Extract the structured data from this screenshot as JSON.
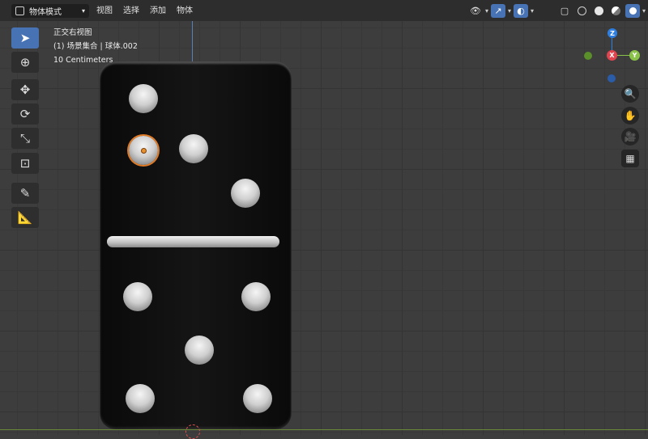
{
  "header": {
    "mode_label": "物体模式",
    "menus": [
      "视图",
      "选择",
      "添加",
      "物体"
    ]
  },
  "overlay": {
    "view_name": "正交右视图",
    "object_info": "(1) 场景集合 | 球体.002",
    "scale_label": "10 Centimeters"
  },
  "toolbar": {
    "tools": [
      "select-box",
      "cursor",
      "move",
      "rotate",
      "scale",
      "transform",
      "annotate",
      "measure"
    ],
    "active": "select-box"
  },
  "gizmo": {
    "z_label": "Z",
    "x_label": "X",
    "y_label": "Y",
    "colors": {
      "x": "#e0454f",
      "y": "#8bc34a",
      "z": "#2f7fe0"
    }
  },
  "scene": {
    "object": "domino",
    "top_half_pips": 4,
    "bottom_half_pips": 5,
    "selected_object": "球体.002",
    "selection_color": "#e07a25"
  }
}
